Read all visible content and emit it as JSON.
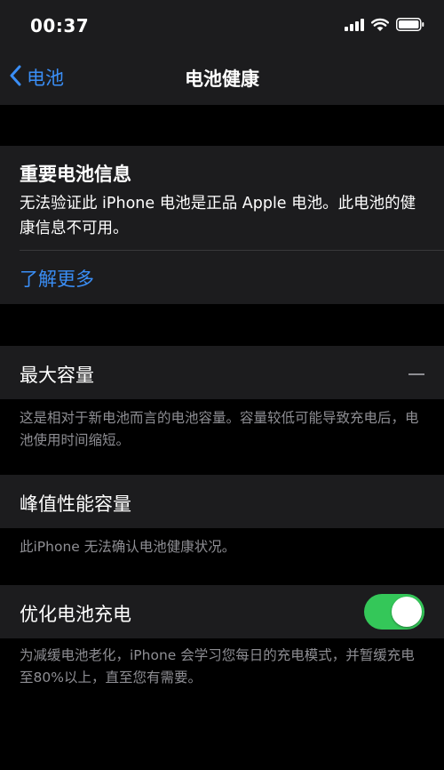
{
  "status": {
    "time": "00:37"
  },
  "nav": {
    "back_label": "电池",
    "title": "电池健康"
  },
  "important": {
    "title": "重要电池信息",
    "message": "无法验证此 iPhone 电池是正品 Apple 电池。此电池的健康信息不可用。",
    "link": "了解更多"
  },
  "max_capacity": {
    "label": "最大容量",
    "value": "—",
    "footer": "这是相对于新电池而言的电池容量。容量较低可能导致充电后，电池使用时间缩短。"
  },
  "peak_performance": {
    "label": "峰值性能容量",
    "footer": "此iPhone 无法确认电池健康状况。"
  },
  "optimized_charging": {
    "label": "优化电池充电",
    "enabled": true,
    "footer": "为减缓电池老化，iPhone 会学习您每日的充电模式，并暂缓充电至80%以上，直至您有需要。"
  },
  "colors": {
    "accent": "#3a8ef6",
    "toggle_on": "#34c759",
    "cell": "#1c1c1e",
    "background": "#000000"
  },
  "icons": [
    "cellular-signal-icon",
    "wifi-icon",
    "battery-icon",
    "chevron-left-icon"
  ]
}
